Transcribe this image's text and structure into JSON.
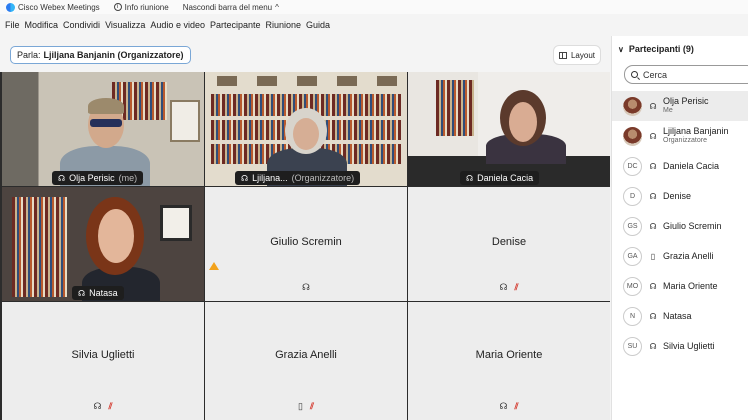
{
  "titlebar": {
    "app": "Cisco Webex Meetings",
    "info": "Info riunione",
    "hide_menu": "Nascondi barra del menu",
    "hide_menu_caret": "^"
  },
  "menu": [
    "File",
    "Modifica",
    "Condividi",
    "Visualizza",
    "Audio e video",
    "Partecipante",
    "Riunione",
    "Guida"
  ],
  "speaker": {
    "prefix": "Parla:",
    "name": "Ljiljana Banjanin (Organizzatore)"
  },
  "layout_button": "Layout",
  "tiles": {
    "olja": {
      "name": "Olja Perisic",
      "suffix": "(me)"
    },
    "ljiljana": {
      "name": "Ljiljana...",
      "suffix": "(Organizzatore)"
    },
    "daniela": {
      "name": "Daniela Cacia"
    },
    "natasa": {
      "name": "Natasa"
    },
    "giulio": {
      "name": "Giulio Scremin"
    },
    "denise": {
      "name": "Denise"
    },
    "silvia": {
      "name": "Silvia Uglietti"
    },
    "grazia": {
      "name": "Grazia Anelli"
    },
    "maria": {
      "name": "Maria Oriente"
    }
  },
  "icons": {
    "headphone": "☊",
    "phone": "▯",
    "muted": "⫽"
  },
  "panel": {
    "title": "Partecipanti (9)",
    "search_placeholder": "Cerca",
    "participants": [
      {
        "initials": "",
        "name": "Olja Perisic",
        "role": "Me",
        "device": "headphone"
      },
      {
        "initials": "",
        "name": "Ljiljana Banjanin",
        "role": "Organizzatore",
        "device": "headphone"
      },
      {
        "initials": "DC",
        "name": "Daniela Cacia",
        "role": "",
        "device": "headphone"
      },
      {
        "initials": "D",
        "name": "Denise",
        "role": "",
        "device": "headphone"
      },
      {
        "initials": "GS",
        "name": "Giulio Scremin",
        "role": "",
        "device": "headphone"
      },
      {
        "initials": "GA",
        "name": "Grazia Anelli",
        "role": "",
        "device": "phone"
      },
      {
        "initials": "MO",
        "name": "Maria Oriente",
        "role": "",
        "device": "headphone"
      },
      {
        "initials": "N",
        "name": "Natasa",
        "role": "",
        "device": "headphone"
      },
      {
        "initials": "SU",
        "name": "Silvia Uglietti",
        "role": "",
        "device": "headphone"
      }
    ]
  },
  "colors": {
    "active_speaker": "#5ab7e8",
    "muted": "#d43a2f",
    "warning": "#f2a21c"
  }
}
